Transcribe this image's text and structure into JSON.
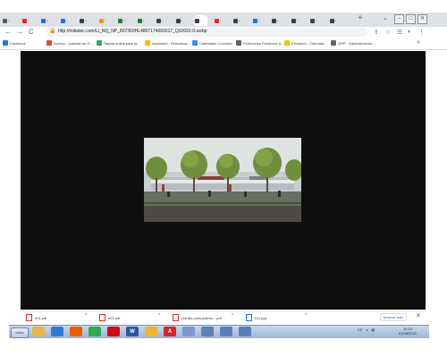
{
  "tabs": {
    "active_title": "",
    "new_tab_glyph": "+",
    "tab_search_glyph": "⌄",
    "window_buttons": [
      "–",
      "□",
      "✕"
    ],
    "items": [
      {
        "color": "#5a5a5a"
      },
      {
        "color": "#d93025"
      },
      {
        "color": "#1a73e8"
      },
      {
        "color": "#1a73e8"
      },
      {
        "color": "#3c4043"
      },
      {
        "color": "#f29900"
      },
      {
        "color": "#188038"
      },
      {
        "color": "#188038"
      },
      {
        "color": "#3c4043"
      },
      {
        "color": "#3c4043"
      },
      {
        "color": "#3c4043"
      },
      {
        "color": "#d93025"
      },
      {
        "color": "#3c4043"
      },
      {
        "color": "#1a73e8"
      },
      {
        "color": "#3c4043"
      },
      {
        "color": "#3c4043"
      },
      {
        "color": "#3c4043"
      },
      {
        "color": "#3c4043"
      }
    ]
  },
  "toolbar": {
    "back_glyph": "←",
    "forward_glyph": "→",
    "reload_glyph": "C",
    "home_glyph": "⌂",
    "lock_glyph": "🔒",
    "url": "http://mitiatec.com/LI_NQ_NP_807369HL4807174660017_Q32022-0.webp",
    "share_glyph": "⇪",
    "star_glyph": "☆",
    "reading_glyph": "☰",
    "profile_glyph": "◐",
    "menu_glyph": "⋮"
  },
  "bookmarks": {
    "items": [
      {
        "label": "Facebook",
        "color": "#1877f2"
      },
      {
        "label": "Acceso - cuentas de G...",
        "color": "#ea4335"
      },
      {
        "label": "Tarjeta online para la...",
        "color": "#34a853"
      },
      {
        "label": "Impresión - Estructura...",
        "color": "#fbbc04"
      },
      {
        "label": "Calendario Colorado",
        "color": "#4285f4"
      },
      {
        "label": "Federación Provincial S...",
        "color": "#5f6368"
      },
      {
        "label": "Escritorio - Calendar...",
        "color": "#fbbc04"
      },
      {
        "label": "AFIP - Administración...",
        "color": "#5f6368"
      }
    ],
    "more_glyph": "»"
  },
  "downloads": {
    "items": [
      {
        "name": "e01.pdf",
        "type": "pdf"
      },
      {
        "name": "e02.pdf",
        "type": "pdf"
      },
      {
        "name": "planilla presupuesto - pdf",
        "type": "pdf"
      },
      {
        "name": "IO1.jpg",
        "type": "img"
      }
    ],
    "chevron_glyph": "^",
    "show_all": "Mostrar todo",
    "close_glyph": "✕"
  },
  "taskbar": {
    "start_label": "Inicio",
    "apps": [
      {
        "name": "folder",
        "color": "#e7b94a"
      },
      {
        "name": "media",
        "color": "#2f7bd1"
      },
      {
        "name": "firefox",
        "color": "#e66000"
      },
      {
        "name": "chrome",
        "color": "#34a853"
      },
      {
        "name": "opera",
        "color": "#cc0f16"
      },
      {
        "name": "word",
        "color": "#2b579a",
        "glyph": "W"
      },
      {
        "name": "picture",
        "color": "#f2b233"
      },
      {
        "name": "acrobat",
        "color": "#d4262b",
        "glyph": "A"
      },
      {
        "name": "paint",
        "color": "#7a9ad0"
      },
      {
        "name": "window1",
        "color": "#5b7fb9"
      },
      {
        "name": "window2",
        "color": "#5b7fb9"
      },
      {
        "name": "window3",
        "color": "#5b7fb9"
      }
    ],
    "tray_lang": "ES",
    "clock_time": "10:19",
    "clock_date": "01/08/2022"
  }
}
